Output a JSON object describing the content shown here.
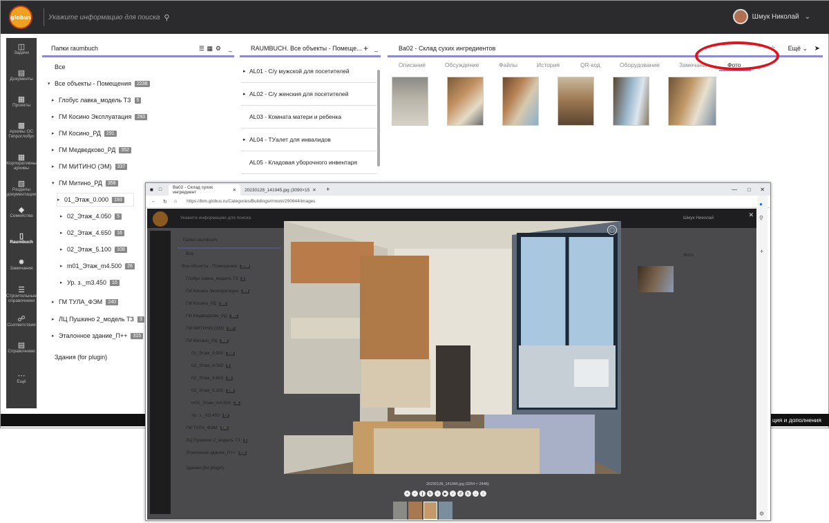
{
  "header": {
    "logo_text": "globus",
    "search_placeholder": "Укажите информацию для поиска",
    "user_name": "Шмук Николай"
  },
  "sidebar": {
    "items": [
      {
        "label": "Задачи",
        "icon": "trash-icon"
      },
      {
        "label": "Документы",
        "icon": "folder-icon"
      },
      {
        "label": "Проекты",
        "icon": "projects-icon"
      },
      {
        "label": "Архивы ОС Гипроглобус",
        "icon": "archive-icon"
      },
      {
        "label": "Корпоративны архивы",
        "icon": "corporate-archive-icon"
      },
      {
        "label": "Разделы документации",
        "icon": "sections-icon"
      },
      {
        "label": "Семейства",
        "icon": "tag-icon"
      },
      {
        "label": "Raumbuch",
        "icon": "raumbuch-icon"
      },
      {
        "label": "Замечания",
        "icon": "bug-icon"
      },
      {
        "label": "Строительные справочники",
        "icon": "list-icon"
      },
      {
        "label": "Соответствия",
        "icon": "link-icon"
      },
      {
        "label": "Справочники",
        "icon": "book-icon"
      },
      {
        "label": "Ещё",
        "icon": "more-icon"
      }
    ]
  },
  "folders_panel": {
    "title": "Папки raumbuch",
    "all_label": "Все",
    "tree": [
      {
        "label": "Все объекты - Помещения",
        "count": "2238",
        "expanded": true
      },
      {
        "label": "Глобус лавка_модель ТЗ",
        "count": "5"
      },
      {
        "label": "ГМ Косино Эксплуатация",
        "count": "293"
      },
      {
        "label": "ГМ Косино_РД",
        "count": "291"
      },
      {
        "label": "ГМ Медведково_РД",
        "count": "352"
      },
      {
        "label": "ГМ МИТИНО (ЭМ)",
        "count": "337"
      },
      {
        "label": "ГМ Митино_РД",
        "count": "358",
        "expanded": true
      },
      {
        "label": "01_Этаж_0.000",
        "count": "193",
        "selected": true
      },
      {
        "label": "02_Этаж_4.050",
        "count": "5"
      },
      {
        "label": "02_Этаж_4.650",
        "count": "16"
      },
      {
        "label": "02_Этаж_5.100",
        "count": "108"
      },
      {
        "label": "m01_Этаж_m4.500",
        "count": "26"
      },
      {
        "label": "Ур. з._m3.450",
        "count": "10"
      },
      {
        "label": "ГМ ТУЛА_ФЭМ",
        "count": "240"
      },
      {
        "label": "ЛЦ Пушкино 2_модель ТЗ",
        "count": "3"
      },
      {
        "label": "Эталонное здание_П++",
        "count": "315"
      }
    ],
    "buildings_label": "Здания (for plugin)"
  },
  "objects_panel": {
    "title": "RAUMBUCH. Все объекты - Помеще...",
    "items": [
      "AL01 - С/у мужской для посетителей",
      "AL02 - С/у женския для посетителей",
      "AL03 - Комната матери и ребенка",
      "AL04 - ТУалет для инвалидов",
      "AL05 - Кладовая уборочного инвентаря"
    ]
  },
  "detail_panel": {
    "title": "Ba02 - Склад сухих ингредиентов",
    "more_label": "Ещё",
    "tabs": [
      "Описание",
      "Обсуждение",
      "Файлы",
      "История",
      "QR-код",
      "Оборудование",
      "Замечания",
      "Фото"
    ],
    "active_tab": "Фото",
    "photo_count": 6
  },
  "footer": {
    "text": "ция и дополнения"
  },
  "browser": {
    "tab_title": "Ba02 - Склад сухих ингредиент",
    "tab2_title": "20230128_141945.jpg (3090×15",
    "url": "https://bim.globus.ru/Categories/Buildings#/room/290644/images",
    "image_caption": "20230128_141945.jpg (3264 × 2448)"
  },
  "colors": {
    "accent": "#8a8ad0",
    "topbar": "#2b2b2e",
    "highlight": "#e0131b"
  }
}
